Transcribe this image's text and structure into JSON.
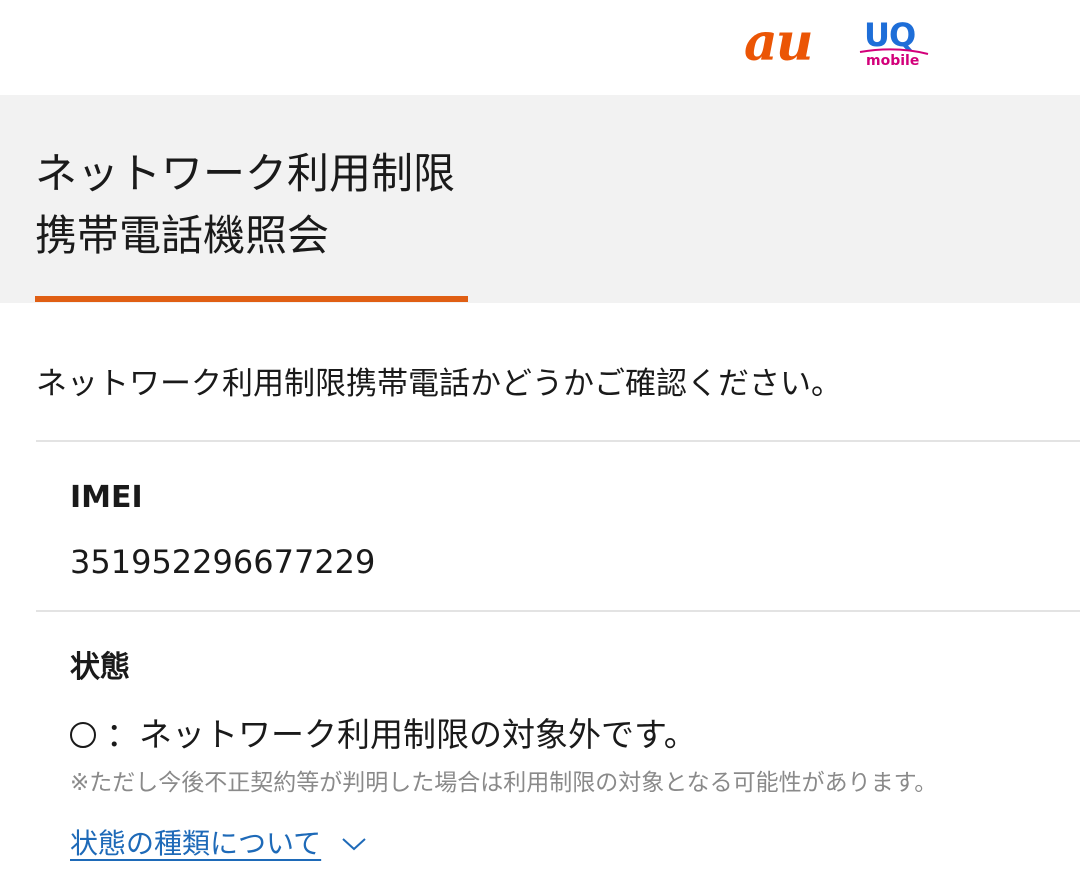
{
  "header": {
    "brand_au": "au",
    "brand_uq": "UQ",
    "brand_uq_sub": "mobile",
    "brand_color_au": "#eb5505",
    "brand_color_uq": "#1e6ed8",
    "brand_color_uq_sub": "#d2007a"
  },
  "page": {
    "title_line1": "ネットワーク利用制限",
    "title_line2": "携帯電話機照会",
    "accent_color": "#e05f14"
  },
  "intro": "ネットワーク利用制限携帯電話かどうかご確認ください。",
  "imei": {
    "label": "IMEI",
    "value": "351952296677229"
  },
  "status": {
    "label": "状態",
    "symbol_icon": "circle-icon",
    "text": "：ネットワーク利用制限の対象外です。",
    "note": "※ただし今後不正契約等が判明した場合は利用制限の対象となる可能性があります。",
    "link_text": "状態の種類について",
    "link_icon": "chevron-down-icon",
    "link_color": "#1e6ab8"
  }
}
